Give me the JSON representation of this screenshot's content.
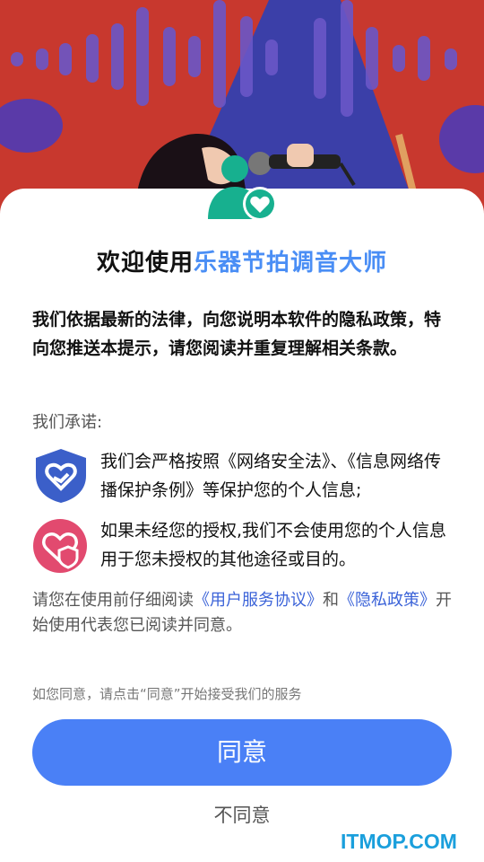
{
  "dialog": {
    "title_prefix": "欢迎使用",
    "app_name": "乐器节拍调音大师",
    "intro": "我们依据最新的法律，向您说明本软件的隐私政策，特向您推送本提示，请您阅读并重复理解相关条款。",
    "promise_label": "我们承诺:",
    "promises": [
      {
        "icon": "shield-heart-icon",
        "text": "我们会严格按照《网络安全法》、《信息网络传播保护条例》等保护您的个人信息;"
      },
      {
        "icon": "heart-shield-icon",
        "text": "如果未经您的授权,我们不会使用您的个人信息用于您未授权的其他途径或目的。"
      }
    ],
    "notice": {
      "part1": "请您在使用前仔细阅读",
      "link_user": "《用户服务协议》",
      "part2": "和",
      "link_privacy": "《隐私政策》",
      "part3": "开始使用代表您已阅读并同意。"
    },
    "hint": "如您同意，请点击“同意”开始接受我们的服务",
    "agree_label": "同意",
    "disagree_label": "不同意"
  },
  "watermark": "ITMOP.COM",
  "colors": {
    "accent": "#4a80f6",
    "app_name": "#4a8ef5",
    "link": "#3b63d8",
    "badge": "#17b08f",
    "header_red": "#c8382e",
    "header_blue": "#3b3fa8"
  }
}
